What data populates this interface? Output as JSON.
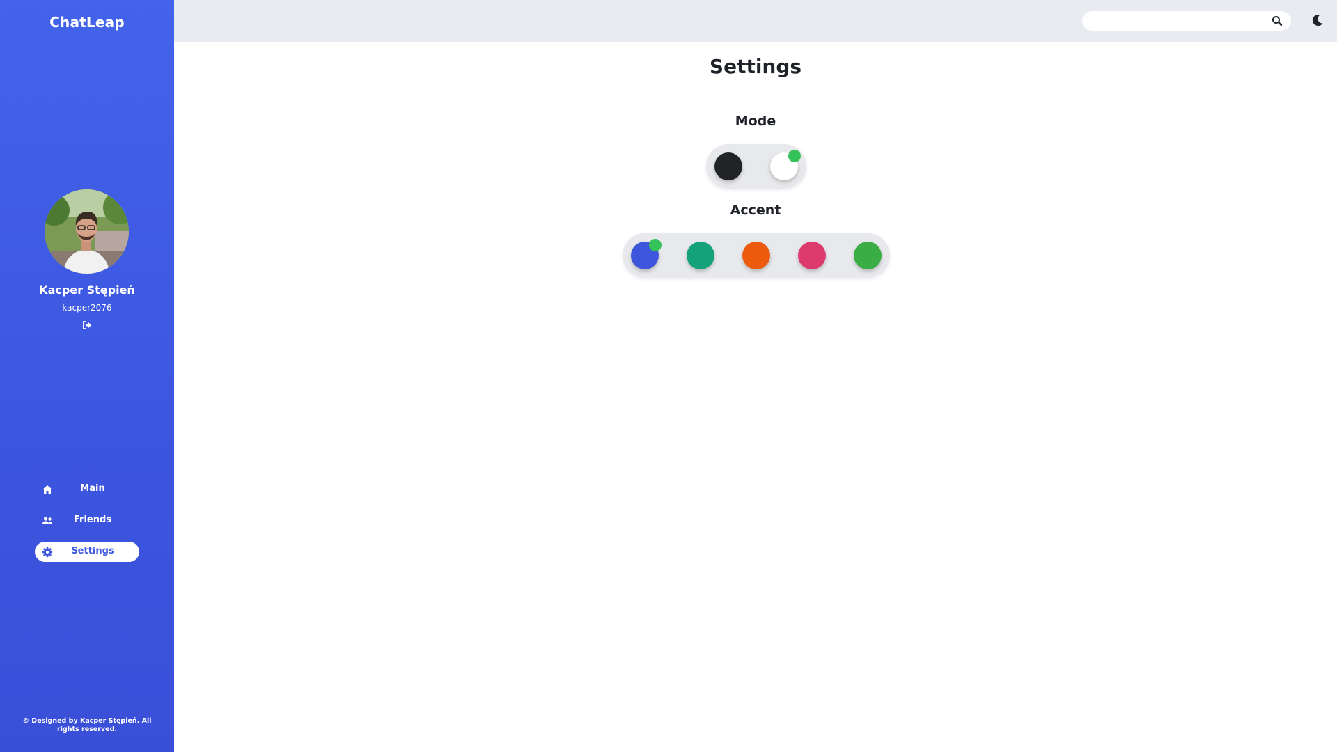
{
  "app": {
    "brand": "ChatLeap"
  },
  "user": {
    "name": "Kacper Stępień",
    "handle": "kacper2076"
  },
  "sidebar": {
    "items": [
      {
        "label": "Main",
        "icon": "home-icon",
        "active": false
      },
      {
        "label": "Friends",
        "icon": "users-icon",
        "active": false
      },
      {
        "label": "Settings",
        "icon": "gear-icon",
        "active": true
      }
    ],
    "footer": "© Designed by Kacper Stępień. All rights reserved."
  },
  "topbar": {
    "search": {
      "value": "",
      "placeholder": ""
    },
    "search_icon": "search-icon",
    "theme_icon": "moon-icon"
  },
  "settings": {
    "title": "Settings",
    "mode": {
      "label": "Mode",
      "options": [
        {
          "name": "dark",
          "color": "#222326",
          "selected": false
        },
        {
          "name": "light",
          "color": "#ffffff",
          "selected": true
        }
      ]
    },
    "accent": {
      "label": "Accent",
      "options": [
        {
          "name": "blue",
          "color": "#3e56dc",
          "selected": true
        },
        {
          "name": "teal",
          "color": "#14a27a",
          "selected": false
        },
        {
          "name": "orange",
          "color": "#ec5b0d",
          "selected": false
        },
        {
          "name": "pink",
          "color": "#dd3a6e",
          "selected": false
        },
        {
          "name": "green",
          "color": "#3aae45",
          "selected": false
        }
      ]
    }
  },
  "colors": {
    "sidebar": "#4160e8",
    "topbar": "#e8ebef",
    "selection_indicator": "#35c25a"
  }
}
